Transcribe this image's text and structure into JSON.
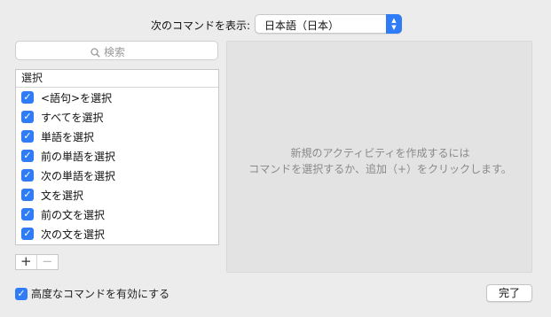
{
  "header": {
    "label": "次のコマンドを表示:",
    "language": "日本語（日本）"
  },
  "search": {
    "placeholder": "検索"
  },
  "list": {
    "header": "選択",
    "items": [
      {
        "label": "<語句>を選択",
        "checked": true
      },
      {
        "label": "すべてを選択",
        "checked": true
      },
      {
        "label": "単語を選択",
        "checked": true
      },
      {
        "label": "前の単語を選択",
        "checked": true
      },
      {
        "label": "次の単語を選択",
        "checked": true
      },
      {
        "label": "文を選択",
        "checked": true
      },
      {
        "label": "前の文を選択",
        "checked": true
      },
      {
        "label": "次の文を選択",
        "checked": true
      }
    ]
  },
  "buttons": {
    "add": "+",
    "remove": "−",
    "done": "完了"
  },
  "detail": {
    "line1": "新規のアクティビティを作成するには",
    "line2": "コマンドを選択するか、追加（+）をクリックします。"
  },
  "advanced": {
    "label": "高度なコマンドを有効にする",
    "checked": true
  },
  "colors": {
    "accent": "#2f7cf6"
  }
}
